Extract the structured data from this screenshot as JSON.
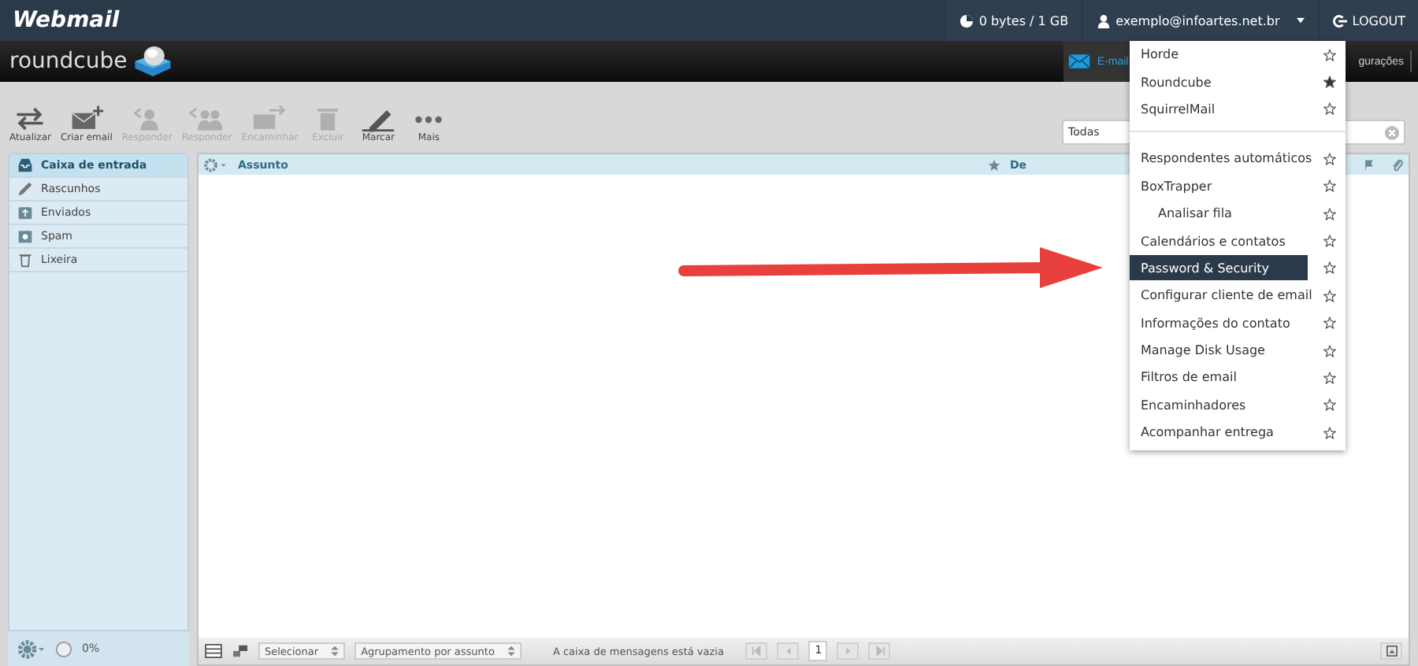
{
  "topbar": {
    "brand": "Webmail",
    "quota": "0 bytes / 1 GB",
    "user": "exemplo@infoartes.net.br",
    "logout": "LOGOUT"
  },
  "header": {
    "logo": "roundcube",
    "nav": [
      {
        "label": "E-mail",
        "kind": "mail",
        "selected": true
      },
      {
        "label": "gurações",
        "kind": "settings",
        "selected": false
      }
    ]
  },
  "toolbar": [
    {
      "label": "Atualizar",
      "kind": "refresh",
      "disabled": false
    },
    {
      "label": "Criar email",
      "kind": "compose",
      "disabled": false
    },
    {
      "label": "Responder",
      "kind": "reply",
      "disabled": true
    },
    {
      "label": "Responder",
      "kind": "replyall",
      "disabled": true
    },
    {
      "label": "Encaminhar",
      "kind": "forward",
      "disabled": true
    },
    {
      "label": "Excluir",
      "kind": "delete",
      "disabled": true
    },
    {
      "label": "Marcar",
      "kind": "mark",
      "disabled": false
    },
    {
      "label": "Mais",
      "kind": "more",
      "disabled": false
    }
  ],
  "search": {
    "value": "Todas"
  },
  "folders": [
    {
      "label": "Caixa de entrada",
      "kind": "inbox",
      "selected": true
    },
    {
      "label": "Rascunhos",
      "kind": "drafts",
      "selected": false
    },
    {
      "label": "Enviados",
      "kind": "sent",
      "selected": false
    },
    {
      "label": "Spam",
      "kind": "spam",
      "selected": false
    },
    {
      "label": "Lixeira",
      "kind": "trash",
      "selected": false
    }
  ],
  "quota": {
    "text": "0%"
  },
  "list": {
    "columns": [
      "Assunto",
      "De"
    ]
  },
  "footer": {
    "select": "Selecionar",
    "threads": "Agrupamento por assunto",
    "status": "A caixa de mensagens está vazia",
    "page": "1"
  },
  "menu": {
    "groups": [
      [
        {
          "label": "Horde",
          "starred": false,
          "selected": false
        },
        {
          "label": "Roundcube",
          "starred": true,
          "selected": false
        },
        {
          "label": "SquirrelMail",
          "starred": false,
          "selected": false
        }
      ],
      [
        {
          "label": "Respondentes automáticos",
          "starred": false,
          "selected": false
        },
        {
          "label": "BoxTrapper",
          "starred": false,
          "selected": false,
          "children": [
            {
              "label": "Analisar fila",
              "starred": false,
              "selected": false
            }
          ]
        },
        {
          "label": "Calendários e contatos",
          "starred": false,
          "selected": false
        },
        {
          "label": "Password & Security",
          "starred": false,
          "selected": true
        },
        {
          "label": "Configurar cliente de email",
          "starred": false,
          "selected": false
        },
        {
          "label": "Informações do contato",
          "starred": false,
          "selected": false
        },
        {
          "label": "Manage Disk Usage",
          "starred": false,
          "selected": false
        },
        {
          "label": "Filtros de email",
          "starred": false,
          "selected": false
        },
        {
          "label": "Encaminhadores",
          "starred": false,
          "selected": false
        },
        {
          "label": "Acompanhar entrega",
          "starred": false,
          "selected": false
        }
      ]
    ]
  }
}
